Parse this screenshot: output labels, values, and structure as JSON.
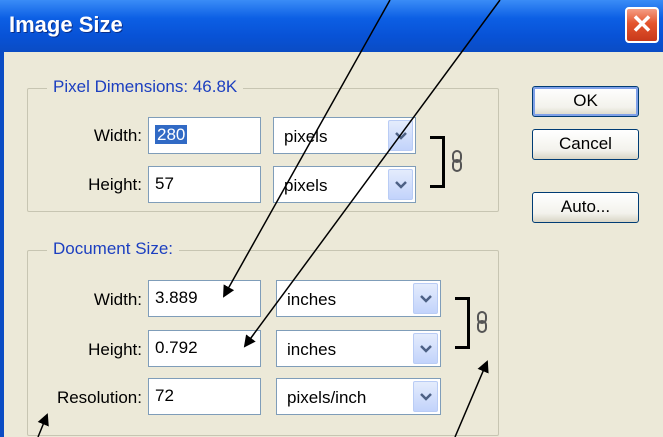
{
  "window": {
    "title": "Image Size"
  },
  "pixel_dimensions": {
    "legend": "Pixel Dimensions:",
    "size": "46.8K",
    "width": {
      "label": "Width:",
      "value": "280",
      "unit": "pixels"
    },
    "height": {
      "label": "Height:",
      "value": "57",
      "unit": "pixels"
    }
  },
  "document_size": {
    "legend": "Document Size:",
    "width": {
      "label": "Width:",
      "value": "3.889",
      "unit": "inches"
    },
    "height": {
      "label": "Height:",
      "value": "0.792",
      "unit": "inches"
    },
    "resolution": {
      "label": "Resolution:",
      "value": "72",
      "unit": "pixels/inch"
    }
  },
  "buttons": {
    "ok": "OK",
    "cancel": "Cancel",
    "auto": "Auto..."
  },
  "icons": {
    "close": "close-icon",
    "link": "chain-link-icon",
    "dropdown": "chevron-down-icon"
  },
  "colors": {
    "titlebar": "#0A4CC4",
    "dialog_bg": "#ECE9D8",
    "legend_text": "#1C3FC0",
    "selection": "#316AC5"
  }
}
